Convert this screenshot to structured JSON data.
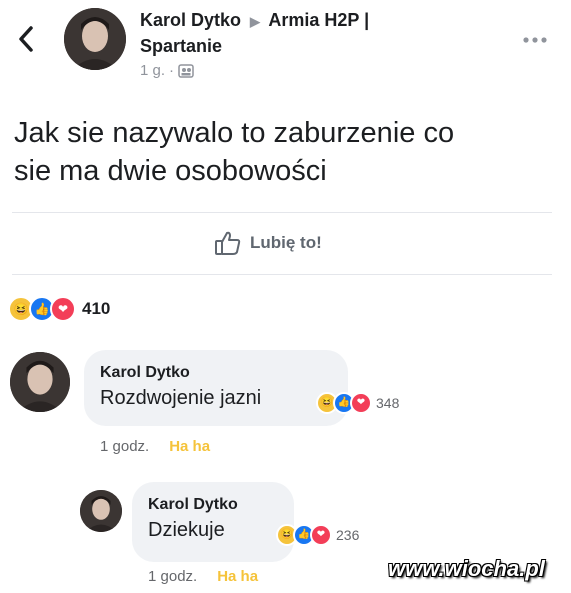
{
  "post": {
    "author": "Karol Dytko",
    "group_line1": "Armia H2P |",
    "group_line2": "Spartanie",
    "time": "1 g.",
    "text_line1": "Jak sie nazywalo to zaburzenie co",
    "text_line2": "sie ma dwie osobowości",
    "like_label": "Lubię to!",
    "reaction_count": "410"
  },
  "comments": [
    {
      "author": "Karol Dytko",
      "text": "Rozdwojenie jazni",
      "reaction_count": "348",
      "time": "1 godz.",
      "reaction_link": "Ha ha"
    },
    {
      "author": "Karol Dytko",
      "text": "Dziekuje",
      "reaction_count": "236",
      "time": "1 godz.",
      "reaction_link": "Ha ha"
    }
  ],
  "watermark": "www.wiocha.pl",
  "icons": {
    "back": "chevron-left-icon",
    "more": "more-dots-icon",
    "audience": "group-icon",
    "like": "thumbs-up-icon",
    "reactions": [
      "haha-reaction-icon",
      "like-reaction-icon",
      "love-reaction-icon"
    ]
  }
}
